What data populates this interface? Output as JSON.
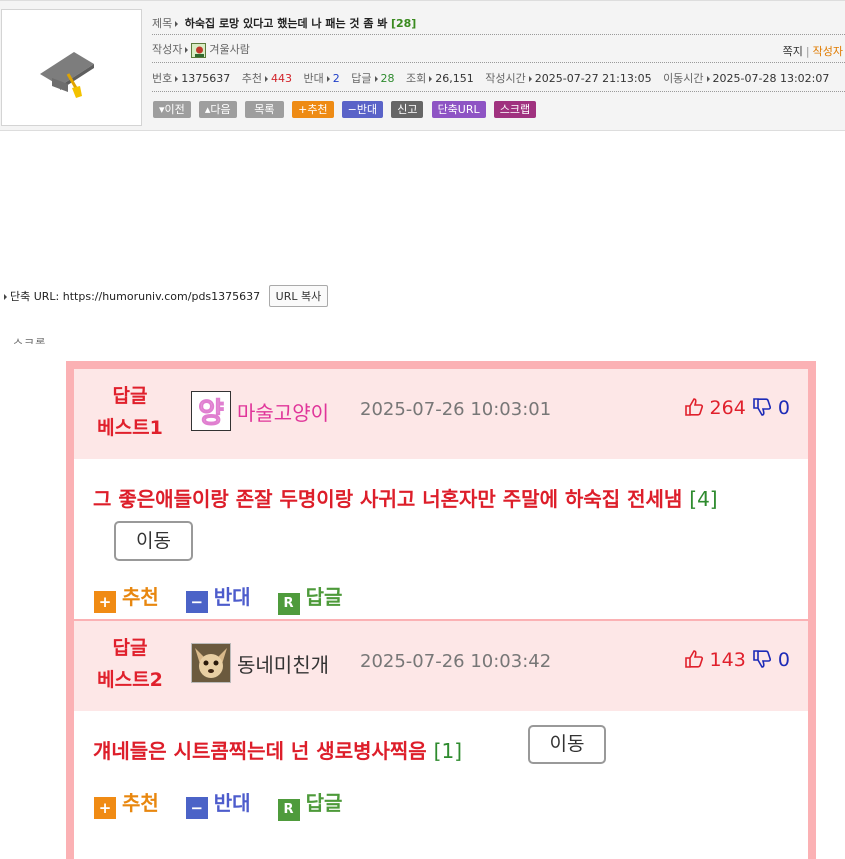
{
  "post": {
    "title_label": "제목",
    "title": "하숙집 로망 있다고 했는데 나 패는 것 좀 봐",
    "comment_count": "[28]",
    "author_label": "작성자",
    "author": "겨울사람",
    "msg_link": "쪽지",
    "articles_link": "작성자",
    "number_label": "번호",
    "number": "1375637",
    "recommend_label": "추천",
    "recommend": "443",
    "oppose_label": "반대",
    "oppose": "2",
    "replies_label": "답글",
    "replies": "28",
    "views_label": "조회",
    "views": "26,151",
    "created_label": "작성시간",
    "created": "2025-07-27 21:13:05",
    "moved_label": "이동시간",
    "moved": "2025-07-28 13:02:07"
  },
  "buttons": {
    "prev": "이전",
    "next": "다음",
    "list": "목록",
    "recommend": "추천",
    "oppose": "반대",
    "report": "신고",
    "short_url": "단축URL",
    "scrap": "스크랩"
  },
  "short_url": {
    "label": "단축 URL:",
    "url": "https://humoruniv.com/pds1375637",
    "copy_button": "URL 복사"
  },
  "cut_label": "스크롤",
  "best_replies": [
    {
      "rank_line1": "답글",
      "rank_line2": "베스트1",
      "avatar": "yang-logo-avatar",
      "name": "마술고양이",
      "name_color": "#e0359a",
      "date": "2025-07-26 10:03:01",
      "up": "264",
      "down": "0",
      "text": "그 좋은애들이랑 존잘 두명이랑 사귀고 너혼자만 주말에 하숙집 전세냄",
      "reply_count": "[4]",
      "move_button": "이동",
      "recommend": "추천",
      "oppose": "반대",
      "reply": "답글"
    },
    {
      "rank_line1": "답글",
      "rank_line2": "베스트2",
      "avatar": "chihuahua-avatar",
      "name": "동네미친개",
      "name_color": "#333333",
      "date": "2025-07-26 10:03:42",
      "up": "143",
      "down": "0",
      "text": "걔네들은 시트콤찍는데 넌 생로병사찍음",
      "reply_count": "[1]",
      "move_button": "이동",
      "recommend": "추천",
      "oppose": "반대",
      "reply": "답글"
    }
  ],
  "colors": {
    "panel_border": "#fbb1b4",
    "panel_bg": "#fde7e7",
    "best_text": "#dd1e2a",
    "up": "#e0202c",
    "down": "#1d2bb7"
  }
}
